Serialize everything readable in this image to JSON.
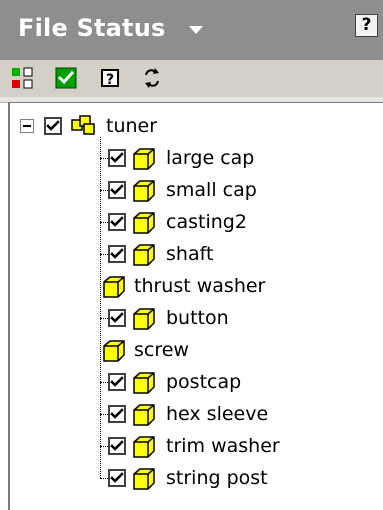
{
  "header": {
    "title": "File Status",
    "help_label": "?"
  },
  "toolbar": {
    "buttons": [
      {
        "name": "grid-colors-icon"
      },
      {
        "name": "check-icon"
      },
      {
        "name": "help-icon"
      },
      {
        "name": "refresh-icon"
      }
    ]
  },
  "tree": {
    "root": {
      "label": "tuner",
      "checked": true
    },
    "items": [
      {
        "label": "large cap",
        "checked": true
      },
      {
        "label": "small cap",
        "checked": true
      },
      {
        "label": "casting2",
        "checked": true
      },
      {
        "label": "shaft",
        "checked": true
      },
      {
        "label": "thrust washer",
        "checked": false
      },
      {
        "label": "button",
        "checked": true
      },
      {
        "label": "screw",
        "checked": false
      },
      {
        "label": "postcap",
        "checked": true
      },
      {
        "label": "hex sleeve",
        "checked": true
      },
      {
        "label": "trim washer",
        "checked": true
      },
      {
        "label": "string post",
        "checked": true
      }
    ]
  },
  "colors": {
    "header_bg": "#8e8e8e",
    "toolbar_bg": "#d4d0c8",
    "part_icon": "#ffff00",
    "check": "#00a000"
  }
}
